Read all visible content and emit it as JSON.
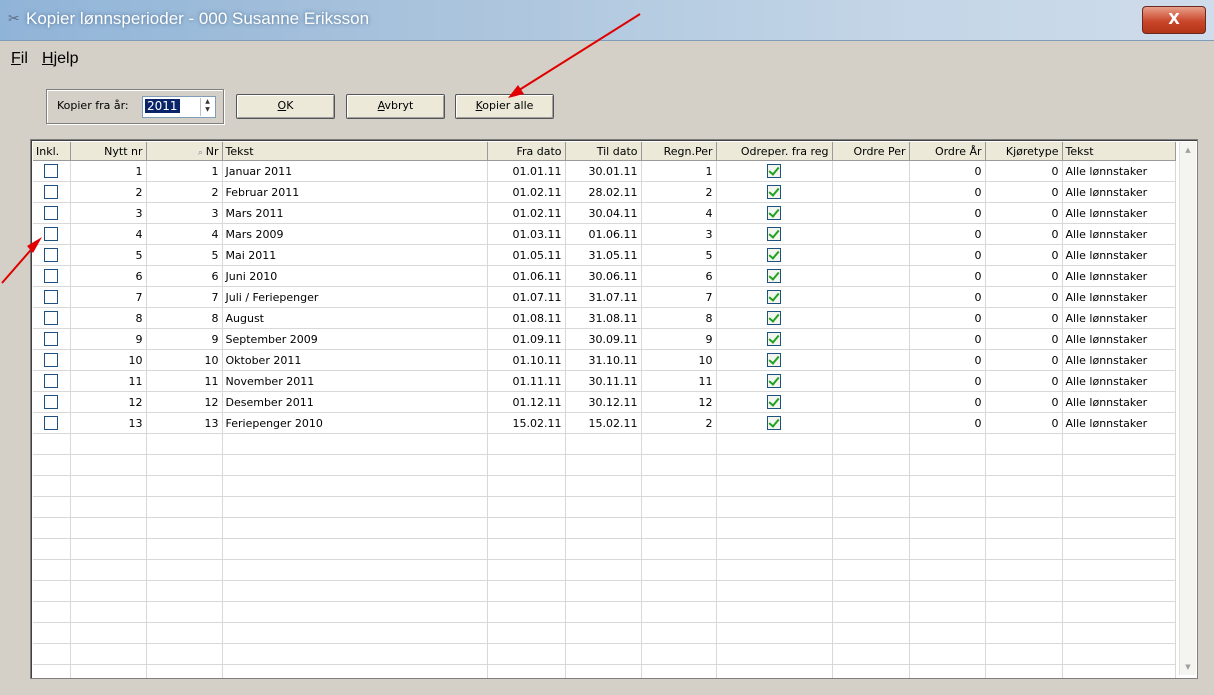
{
  "window": {
    "title": "Kopier lønnsperioder - 000 Susanne Eriksson",
    "close_label": "X"
  },
  "menu": {
    "fil_prefix": "F",
    "fil_rest": "il",
    "hjelp_prefix": "H",
    "hjelp_rest": "jelp"
  },
  "toolbar": {
    "year_label": "Kopier fra år:",
    "year_value": "2011",
    "ok_prefix": "O",
    "ok_rest": "K",
    "cancel_prefix": "A",
    "cancel_rest": "vbryt",
    "copyall_prefix": "K",
    "copyall_rest": "opier alle"
  },
  "grid": {
    "headers": [
      "Inkl.",
      "Nytt nr",
      "Nr",
      "Tekst",
      "Fra dato",
      "Til dato",
      "Regn.Per",
      "Odreper. fra reg",
      "Ordre Per",
      "Ordre År",
      "Kjøretype",
      "Tekst"
    ],
    "rows": [
      {
        "inkl": false,
        "nytt": "1",
        "nr": "1",
        "tekst": "Januar 2011",
        "fra": "01.01.11",
        "til": "30.01.11",
        "regn": "1",
        "odreper": true,
        "ordreper": "",
        "ordrear": "0",
        "kjore": "0",
        "tekst2": "Alle lønnstaker"
      },
      {
        "inkl": false,
        "nytt": "2",
        "nr": "2",
        "tekst": "Februar 2011",
        "fra": "01.02.11",
        "til": "28.02.11",
        "regn": "2",
        "odreper": true,
        "ordreper": "",
        "ordrear": "0",
        "kjore": "0",
        "tekst2": "Alle lønnstaker"
      },
      {
        "inkl": false,
        "nytt": "3",
        "nr": "3",
        "tekst": "Mars 2011",
        "fra": "01.02.11",
        "til": "30.04.11",
        "regn": "4",
        "odreper": true,
        "ordreper": "",
        "ordrear": "0",
        "kjore": "0",
        "tekst2": "Alle lønnstaker"
      },
      {
        "inkl": false,
        "nytt": "4",
        "nr": "4",
        "tekst": "Mars 2009",
        "fra": "01.03.11",
        "til": "01.06.11",
        "regn": "3",
        "odreper": true,
        "ordreper": "",
        "ordrear": "0",
        "kjore": "0",
        "tekst2": "Alle lønnstaker"
      },
      {
        "inkl": false,
        "nytt": "5",
        "nr": "5",
        "tekst": "Mai 2011",
        "fra": "01.05.11",
        "til": "31.05.11",
        "regn": "5",
        "odreper": true,
        "ordreper": "",
        "ordrear": "0",
        "kjore": "0",
        "tekst2": "Alle lønnstaker"
      },
      {
        "inkl": false,
        "nytt": "6",
        "nr": "6",
        "tekst": "Juni 2010",
        "fra": "01.06.11",
        "til": "30.06.11",
        "regn": "6",
        "odreper": true,
        "ordreper": "",
        "ordrear": "0",
        "kjore": "0",
        "tekst2": "Alle lønnstaker"
      },
      {
        "inkl": false,
        "nytt": "7",
        "nr": "7",
        "tekst": "Juli / Feriepenger",
        "fra": "01.07.11",
        "til": "31.07.11",
        "regn": "7",
        "odreper": true,
        "ordreper": "",
        "ordrear": "0",
        "kjore": "0",
        "tekst2": "Alle lønnstaker"
      },
      {
        "inkl": false,
        "nytt": "8",
        "nr": "8",
        "tekst": "August",
        "fra": "01.08.11",
        "til": "31.08.11",
        "regn": "8",
        "odreper": true,
        "ordreper": "",
        "ordrear": "0",
        "kjore": "0",
        "tekst2": "Alle lønnstaker"
      },
      {
        "inkl": false,
        "nytt": "9",
        "nr": "9",
        "tekst": "September 2009",
        "fra": "01.09.11",
        "til": "30.09.11",
        "regn": "9",
        "odreper": true,
        "ordreper": "",
        "ordrear": "0",
        "kjore": "0",
        "tekst2": "Alle lønnstaker"
      },
      {
        "inkl": false,
        "nytt": "10",
        "nr": "10",
        "tekst": "Oktober 2011",
        "fra": "01.10.11",
        "til": "31.10.11",
        "regn": "10",
        "odreper": true,
        "ordreper": "",
        "ordrear": "0",
        "kjore": "0",
        "tekst2": "Alle lønnstaker"
      },
      {
        "inkl": false,
        "nytt": "11",
        "nr": "11",
        "tekst": "November 2011",
        "fra": "01.11.11",
        "til": "30.11.11",
        "regn": "11",
        "odreper": true,
        "ordreper": "",
        "ordrear": "0",
        "kjore": "0",
        "tekst2": "Alle lønnstaker"
      },
      {
        "inkl": false,
        "nytt": "12",
        "nr": "12",
        "tekst": "Desember 2011",
        "fra": "01.12.11",
        "til": "30.12.11",
        "regn": "12",
        "odreper": true,
        "ordreper": "",
        "ordrear": "0",
        "kjore": "0",
        "tekst2": "Alle lønnstaker"
      },
      {
        "inkl": false,
        "nytt": "13",
        "nr": "13",
        "tekst": "Feriepenger 2010",
        "fra": "15.02.11",
        "til": "15.02.11",
        "regn": "2",
        "odreper": true,
        "ordreper": "",
        "ordrear": "0",
        "kjore": "0",
        "tekst2": "Alle lønnstaker"
      }
    ]
  },
  "colors": {
    "annotation_arrow": "#e00000",
    "selection": "#0a246a",
    "check": "#21a121"
  },
  "icons": {
    "app": "scissors-icon",
    "close": "close-icon",
    "search": "search-icon"
  }
}
